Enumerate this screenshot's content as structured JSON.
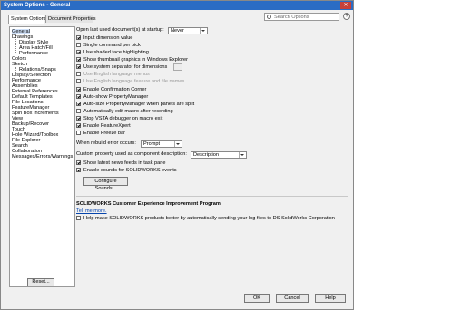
{
  "window": {
    "title": "System Options - General",
    "close_glyph": "✕"
  },
  "tabs": [
    {
      "label": "System Options"
    },
    {
      "label": "Document Properties"
    }
  ],
  "search": {
    "placeholder": "Search Options",
    "help_glyph": "?"
  },
  "tree": {
    "items": [
      "General",
      "Drawings",
      "Display Style",
      "Area Hatch/Fill",
      "Performance",
      "Colors",
      "Sketch",
      "Relations/Snaps",
      "Display/Selection",
      "Performance",
      "Assemblies",
      "External References",
      "Default Templates",
      "File Locations",
      "FeatureManager",
      "Spin Box Increments",
      "View",
      "Backup/Recover",
      "Touch",
      "Hole Wizard/Toolbox",
      "File Explorer",
      "Search",
      "Collaboration",
      "Messages/Errors/Warnings"
    ],
    "reset_label": "Reset..."
  },
  "general": {
    "open_last_label": "Open last used document(s) at startup:",
    "open_last_value": "Never",
    "checks": [
      {
        "label": "Input dimension value",
        "checked": true,
        "disabled": false
      },
      {
        "label": "Single command per pick",
        "checked": false,
        "disabled": false
      },
      {
        "label": "Use shaded face highlighting",
        "checked": true,
        "disabled": false
      },
      {
        "label": "Show thumbnail graphics in Windows Explorer",
        "checked": true,
        "disabled": false
      },
      {
        "label": "Use system separator for dimensions",
        "checked": true,
        "disabled": false
      },
      {
        "label": "Use English language menus",
        "checked": false,
        "disabled": true
      },
      {
        "label": "Use English language feature and file names",
        "checked": false,
        "disabled": true
      },
      {
        "label": "Enable Confirmation Corner",
        "checked": true,
        "disabled": false
      },
      {
        "label": "Auto-show PropertyManager",
        "checked": true,
        "disabled": false
      },
      {
        "label": "Auto-size PropertyManager when panels are split",
        "checked": true,
        "disabled": false
      },
      {
        "label": "Automatically edit macro after recording",
        "checked": false,
        "disabled": false
      },
      {
        "label": "Stop VSTA debugger on macro exit",
        "checked": true,
        "disabled": false
      },
      {
        "label": "Enable FeatureXpert",
        "checked": true,
        "disabled": false
      },
      {
        "label": "Enable Freeze bar",
        "checked": false,
        "disabled": false
      }
    ],
    "rebuild_label": "When rebuild error occurs:",
    "rebuild_value": "Prompt",
    "custom_prop_label": "Custom property used as component description:",
    "custom_prop_value": "Description",
    "news_label": "Show latest news feeds in task pane",
    "sounds_label": "Enable sounds for SOLIDWORKS events",
    "configure_sounds": "Configure Sounds...",
    "ceip_title": "SOLIDWORKS Customer Experience Improvement Program",
    "tell_more": "Tell me more.",
    "ceip_check": "Help make SOLIDWORKS products better by automatically sending your log files to DS SolidWorks Corporation"
  },
  "footer": {
    "ok": "OK",
    "cancel": "Cancel",
    "help": "Help"
  }
}
